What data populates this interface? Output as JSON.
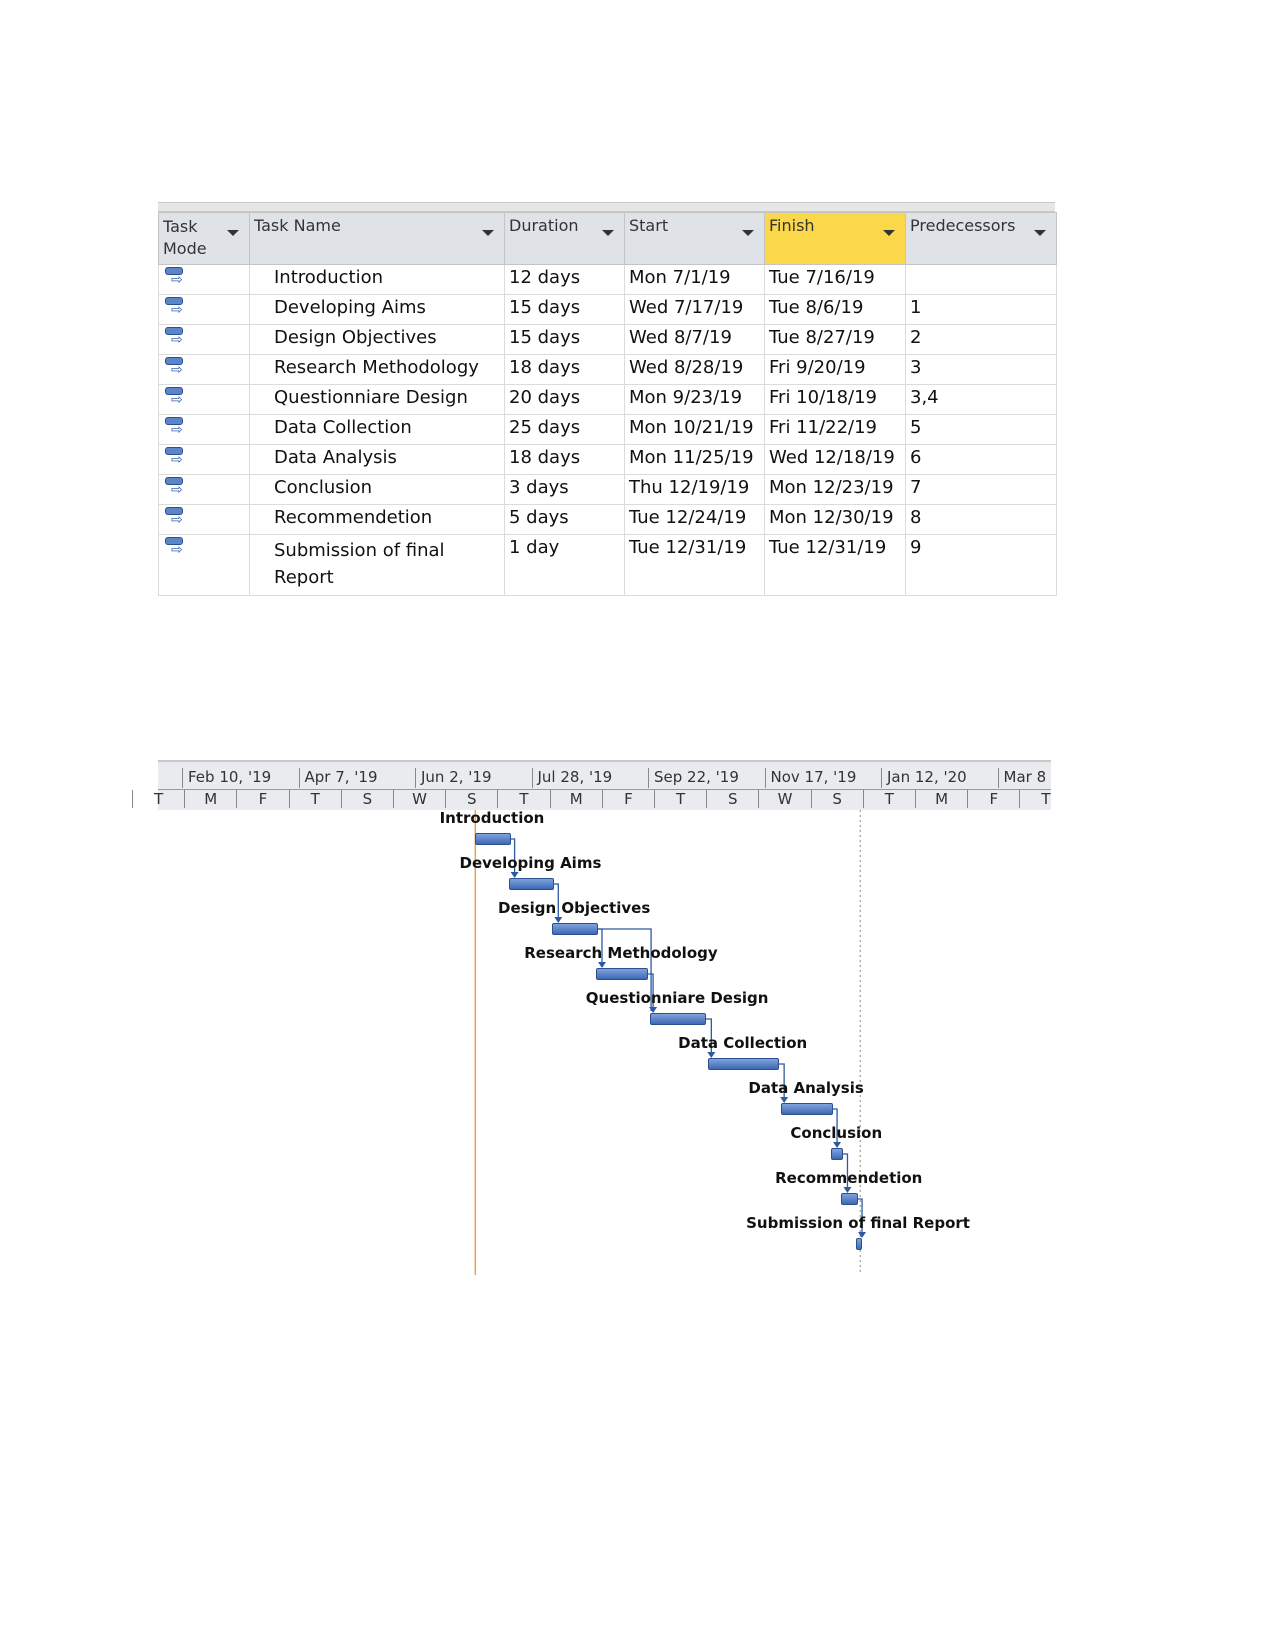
{
  "table": {
    "columns": [
      "Task Mode",
      "Task Name",
      "Duration",
      "Start",
      "Finish",
      "Predecessors"
    ],
    "selected_column": "Finish",
    "rows": [
      {
        "name": "Introduction",
        "duration": "12 days",
        "start": "Mon 7/1/19",
        "finish": "Tue 7/16/19",
        "pred": ""
      },
      {
        "name": "Developing Aims",
        "duration": "15 days",
        "start": "Wed 7/17/19",
        "finish": "Tue 8/6/19",
        "pred": "1"
      },
      {
        "name": "Design Objectives",
        "duration": "15 days",
        "start": "Wed 8/7/19",
        "finish": "Tue 8/27/19",
        "pred": "2"
      },
      {
        "name": "Research Methodology",
        "duration": "18 days",
        "start": "Wed 8/28/19",
        "finish": "Fri 9/20/19",
        "pred": "3"
      },
      {
        "name": "Questionniare Design",
        "duration": "20 days",
        "start": "Mon 9/23/19",
        "finish": "Fri 10/18/19",
        "pred": "3,4"
      },
      {
        "name": "Data Collection",
        "duration": "25 days",
        "start": "Mon 10/21/19",
        "finish": "Fri 11/22/19",
        "pred": "5"
      },
      {
        "name": "Data Analysis",
        "duration": "18 days",
        "start": "Mon 11/25/19",
        "finish": "Wed 12/18/19",
        "pred": "6"
      },
      {
        "name": "Conclusion",
        "duration": "3 days",
        "start": "Thu 12/19/19",
        "finish": "Mon 12/23/19",
        "pred": "7"
      },
      {
        "name": "Recommendetion",
        "duration": "5 days",
        "start": "Tue 12/24/19",
        "finish": "Mon 12/30/19",
        "pred": "8"
      },
      {
        "name": "Submission of final Report",
        "duration": "1 day",
        "start": "Tue 12/31/19",
        "finish": "Tue 12/31/19",
        "pred": "9"
      }
    ]
  },
  "gantt": {
    "major_ticks": [
      "Feb 10, '19",
      "Apr 7, '19",
      "Jun 2, '19",
      "Jul 28, '19",
      "Sep 22, '19",
      "Nov 17, '19",
      "Jan 12, '20",
      "Mar 8"
    ],
    "minor_ticks": [
      "T",
      "M",
      "F",
      "T",
      "S",
      "W",
      "S",
      "T",
      "M",
      "F",
      "T",
      "S",
      "W",
      "S",
      "T",
      "M",
      "F",
      "T"
    ],
    "tasks": [
      {
        "label": "Introduction",
        "start": "2019-07-01",
        "finish": "2019-07-16"
      },
      {
        "label": "Developing Aims",
        "start": "2019-07-17",
        "finish": "2019-08-06"
      },
      {
        "label": "Design Objectives",
        "start": "2019-08-07",
        "finish": "2019-08-27"
      },
      {
        "label": "Research Methodology",
        "start": "2019-08-28",
        "finish": "2019-09-20"
      },
      {
        "label": "Questionniare Design",
        "start": "2019-09-23",
        "finish": "2019-10-18"
      },
      {
        "label": "Data Collection",
        "start": "2019-10-21",
        "finish": "2019-11-22"
      },
      {
        "label": "Data Analysis",
        "start": "2019-11-25",
        "finish": "2019-12-18"
      },
      {
        "label": "Conclusion",
        "start": "2019-12-19",
        "finish": "2019-12-23"
      },
      {
        "label": "Recommendetion",
        "start": "2019-12-24",
        "finish": "2019-12-30"
      },
      {
        "label": "Submission of final Report",
        "start": "2019-12-31",
        "finish": "2019-12-31"
      }
    ],
    "colors": {
      "bar": "#4a76c0",
      "project_start_line": "#f0a050",
      "link": "#2c5aa0"
    }
  }
}
